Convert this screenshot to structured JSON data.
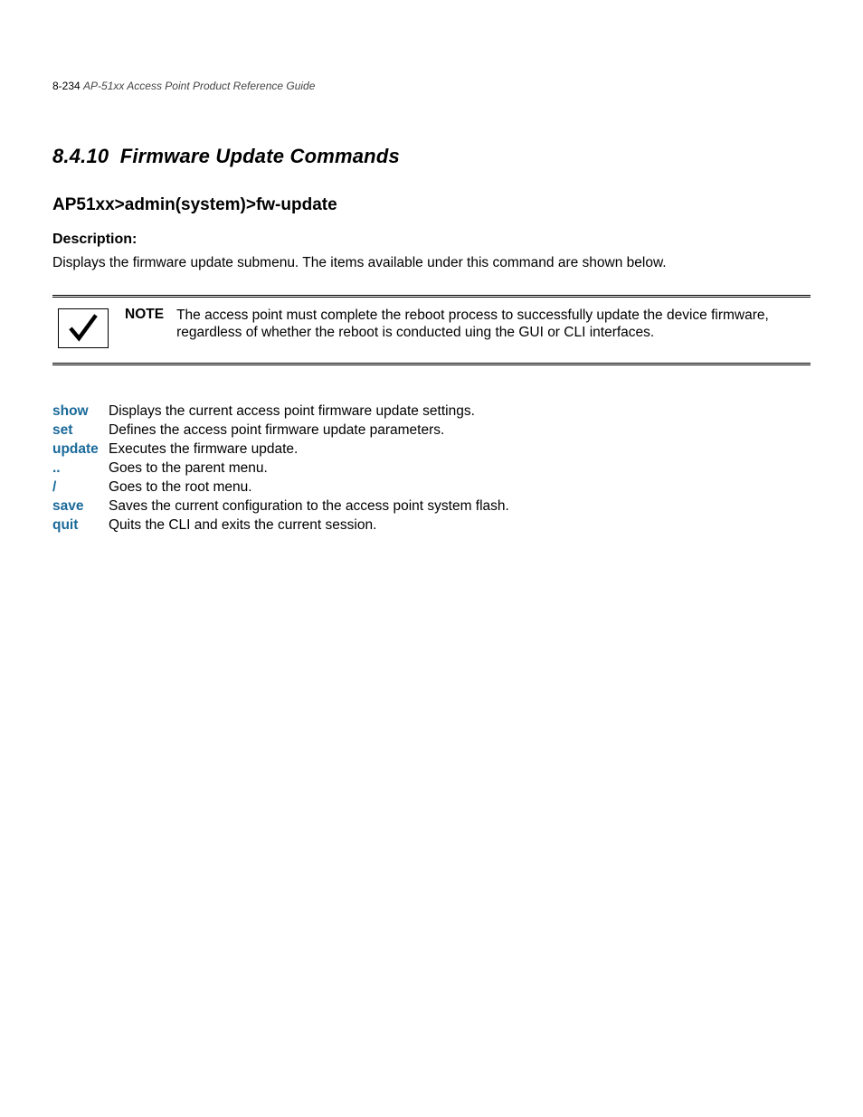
{
  "header": {
    "page_number": "8-234",
    "guide_title": "AP-51xx Access Point Product Reference Guide"
  },
  "section": {
    "number": "8.4.10",
    "title": "Firmware Update Commands"
  },
  "subheading": "AP51xx>admin(system)>fw-update",
  "description": {
    "label": "Description:",
    "text": "Displays the firmware update submenu. The items available under this command are shown below."
  },
  "note": {
    "label": "NOTE",
    "text": "The access point must complete the reboot process to successfully update the device firmware, regardless of whether the reboot is conducted uing the GUI or CLI interfaces."
  },
  "commands": [
    {
      "name": "show",
      "desc": "Displays the current access point firmware update settings."
    },
    {
      "name": "set",
      "desc": "Defines the access point firmware update parameters."
    },
    {
      "name": "update",
      "desc": "Executes the firmware update."
    },
    {
      "name": "..",
      "desc": "Goes to the parent menu."
    },
    {
      "name": "/",
      "desc": "Goes to the root menu."
    },
    {
      "name": "save",
      "desc": "Saves the current configuration to the access point system flash."
    },
    {
      "name": "quit",
      "desc": "Quits the CLI and exits the current session."
    }
  ]
}
